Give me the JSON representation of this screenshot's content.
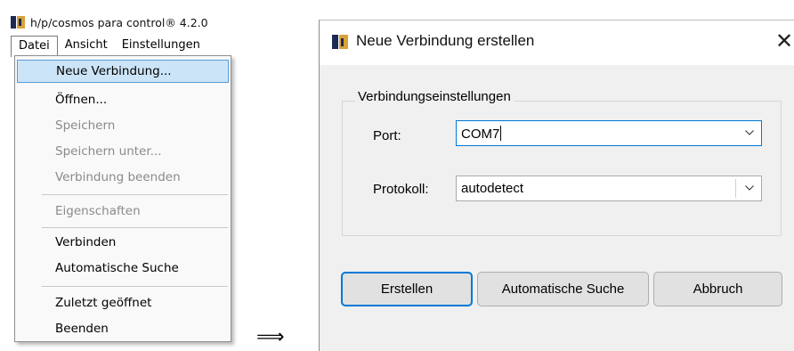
{
  "app": {
    "title": "h/p/cosmos para control® 4.2.0",
    "icon": "app-logo-icon"
  },
  "menubar": {
    "items": [
      {
        "label": "Datei",
        "active": true
      },
      {
        "label": "Ansicht",
        "active": false
      },
      {
        "label": "Einstellungen",
        "active": false
      }
    ]
  },
  "file_menu": {
    "items": [
      {
        "label": "Neue Verbindung...",
        "state": "highlighted"
      },
      {
        "label": "Öffnen...",
        "state": "enabled"
      },
      {
        "label": "Speichern",
        "state": "disabled"
      },
      {
        "label": "Speichern unter...",
        "state": "disabled"
      },
      {
        "label": "Verbindung beenden",
        "state": "disabled"
      },
      {
        "label": "Eigenschaften",
        "state": "disabled"
      },
      {
        "label": "Verbinden",
        "state": "enabled"
      },
      {
        "label": "Automatische Suche",
        "state": "enabled"
      },
      {
        "label": "Zuletzt geöffnet",
        "state": "enabled"
      },
      {
        "label": "Beenden",
        "state": "enabled"
      }
    ]
  },
  "arrow": "⟹",
  "dialog": {
    "title": "Neue Verbindung erstellen",
    "close_icon": "close-icon",
    "group_title": "Verbindungseinstellungen",
    "port": {
      "label": "Port:",
      "value": "COM7"
    },
    "protocol": {
      "label": "Protokoll:",
      "value": "autodetect"
    },
    "buttons": {
      "create": "Erstellen",
      "auto_search": "Automatische Suche",
      "cancel": "Abbruch"
    }
  },
  "colors": {
    "highlight_bg": "#cce4f7",
    "highlight_border": "#5a9bd8",
    "focus_blue": "#0078d7",
    "dialog_bg": "#f0f0f0",
    "disabled_text": "#8a8a8a"
  }
}
